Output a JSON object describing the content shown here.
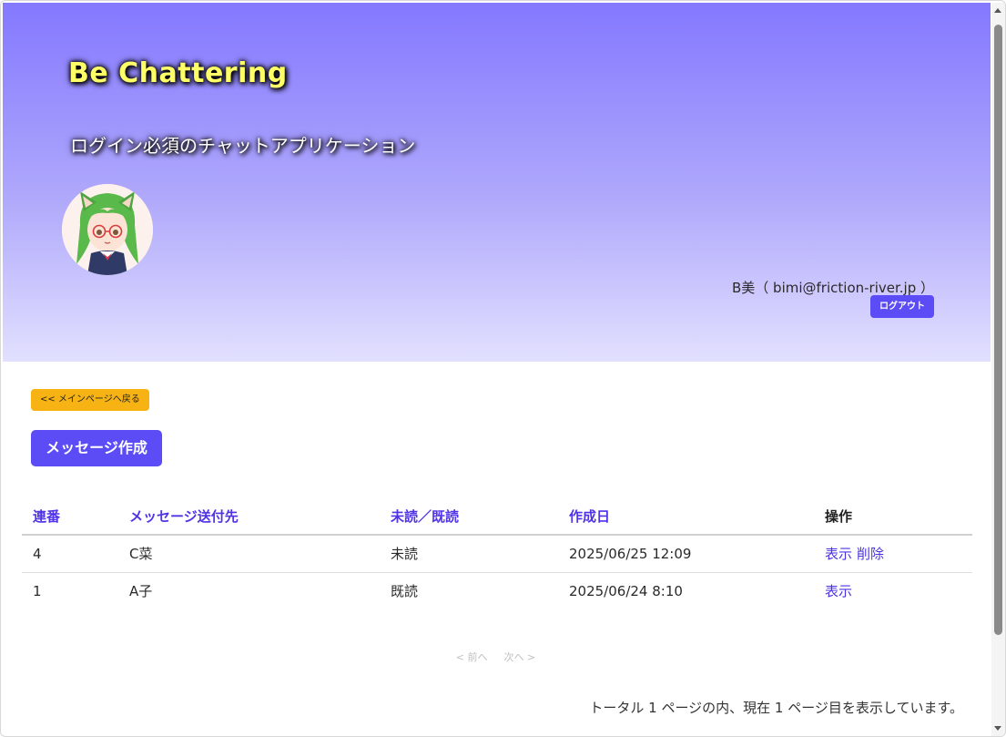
{
  "header": {
    "app_title": "Be Chattering",
    "app_subtitle": "ログイン必須のチャットアプリケーション",
    "user_info": "B美（ bimi@friction-river.jp ）",
    "logout_label": "ログアウト"
  },
  "actions": {
    "back_label": "<< メインページへ戻る",
    "compose_label": "メッセージ作成"
  },
  "table": {
    "headers": {
      "serial": "連番",
      "recipient": "メッセージ送付先",
      "status": "未読／既読",
      "created": "作成日",
      "ops": "操作"
    },
    "rows": [
      {
        "serial": "4",
        "recipient": "C菜",
        "status": "未読",
        "created": "2025/06/25 12:09",
        "view": "表示",
        "delete": "削除"
      },
      {
        "serial": "1",
        "recipient": "A子",
        "status": "既読",
        "created": "2025/06/24 8:10",
        "view": "表示"
      }
    ]
  },
  "pager": {
    "prev_label": "< 前へ",
    "next_label": "次へ >",
    "summary": "トータル 1 ページの内、現在 1 ページ目を表示しています。"
  },
  "colors": {
    "accent": "#5b4cf5",
    "link": "#4b34e0",
    "back_button": "#f7b314",
    "title_text": "#ffff66"
  }
}
